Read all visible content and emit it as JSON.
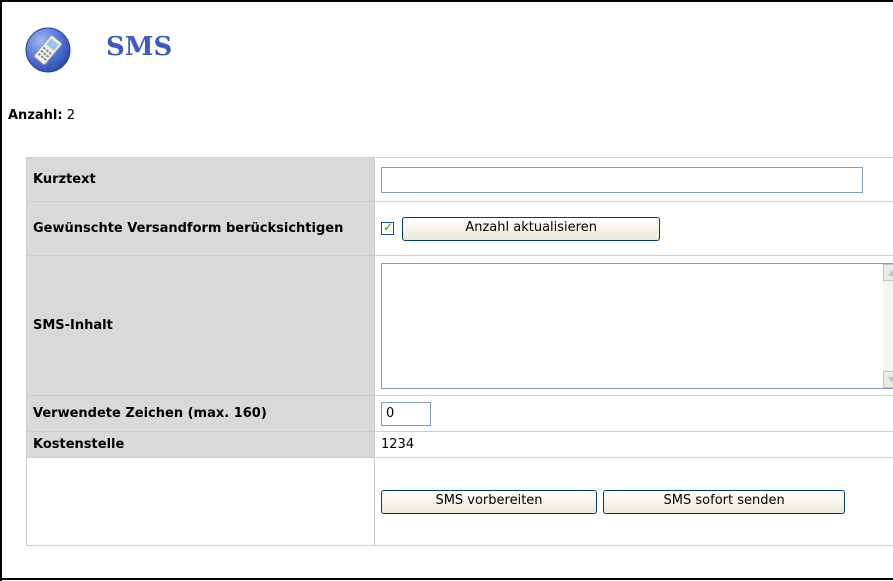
{
  "header": {
    "title": "SMS",
    "icon": "mobile-phone-icon"
  },
  "summary": {
    "count_label": "Anzahl",
    "count_value": "2"
  },
  "form": {
    "kurztext": {
      "label": "Kurztext",
      "value": ""
    },
    "versandform": {
      "label": "Gewünschte Versandform berücksichtigen",
      "checked": true,
      "button_label": "Anzahl aktualisieren"
    },
    "inhalt": {
      "label": "SMS-Inhalt",
      "value": ""
    },
    "zeichen": {
      "label": "Verwendete Zeichen (max. 160)",
      "value": "0"
    },
    "kostenstelle": {
      "label": "Kostenstelle",
      "value": "1234"
    },
    "actions": {
      "prepare_label": "SMS vorbereiten",
      "send_label": "SMS sofort senden"
    }
  },
  "colors": {
    "title": "#3c59c8",
    "label_bg": "#d9d9d9",
    "input_border": "#7f9db9",
    "check": "#21a121"
  }
}
